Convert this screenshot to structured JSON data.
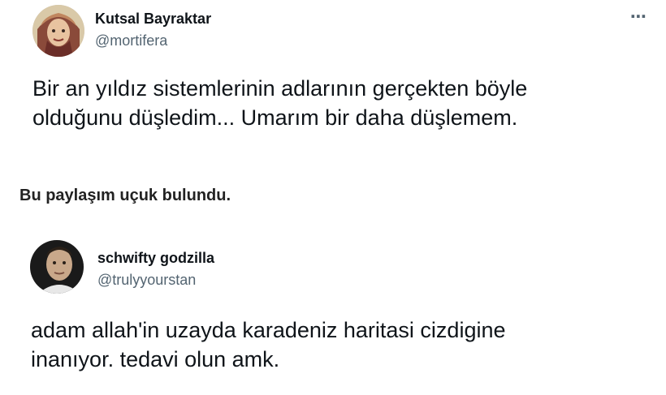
{
  "tweets": [
    {
      "display_name": "Kutsal Bayraktar",
      "handle": "@mortifera",
      "text": "Bir an yıldız sistemlerinin adlarının gerçekten böyle\nolduğunu düşledim... Umarım bir daha düşlemem.",
      "more_icon": "⋯"
    },
    {
      "display_name": "schwifty godzilla",
      "handle": "@trulyyourstan",
      "text": "adam allah'in uzayda karadeniz haritasi cizdigine\ninanıyor. tedavi olun amk."
    }
  ],
  "caption": "Bu paylaşım uçuk bulundu."
}
